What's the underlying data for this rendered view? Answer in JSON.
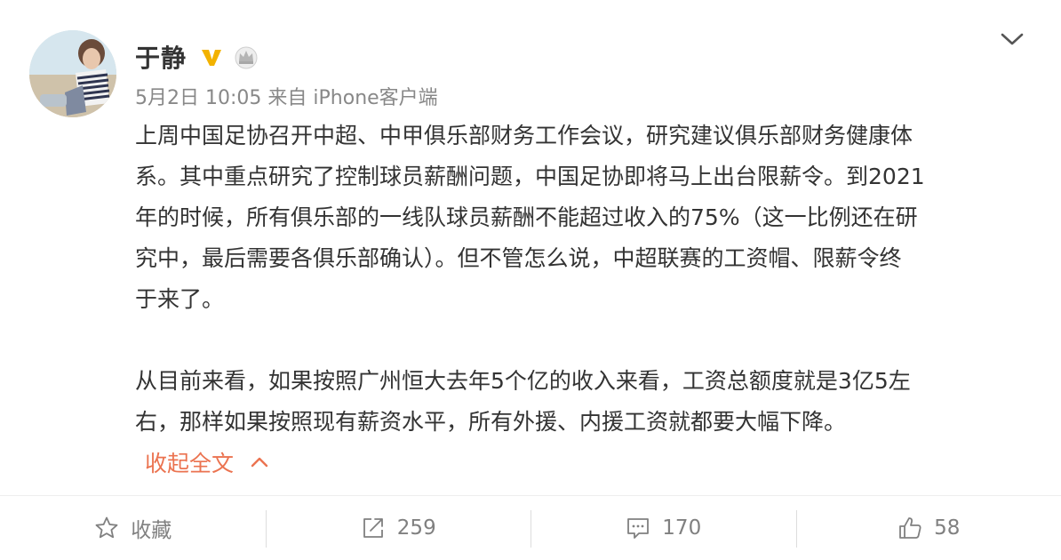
{
  "post": {
    "author": "于静",
    "meta": {
      "date": "5月2日",
      "time": "10:05",
      "source_prefix": "来自",
      "source": "iPhone客户端"
    },
    "paragraphs": [
      "上周中国足协召开中超、中甲俱乐部财务工作会议，研究建议俱乐部财务健康体\n系。其中重点研究了控制球员薪酬问题，中国足协即将马上出台限薪令。到2021\n年的时候，所有俱乐部的一线队球员薪酬不能超过收入的75%（这一比例还在研\n究中，最后需要各俱乐部确认）。但不管怎么说，中超联赛的工资帽、限薪令终\n于来了。",
      "从目前来看，如果按照广州恒大去年5个亿的收入来看，工资总额度就是3亿5左\n右，那样如果按照现有薪资水平，所有外援、内援工资就都要大幅下降。"
    ],
    "collapse_label": "收起全文"
  },
  "actions": {
    "favorite": {
      "label": "收藏",
      "icon": "star-icon"
    },
    "repost": {
      "count": "259",
      "icon": "share-icon"
    },
    "comment": {
      "count": "170",
      "icon": "comment-icon"
    },
    "like": {
      "count": "58",
      "icon": "thumbs-up-icon"
    }
  },
  "colors": {
    "text": "#333333",
    "meta": "#888888",
    "accent": "#eb7350",
    "verified": "#f2b200",
    "icon": "#808080"
  }
}
